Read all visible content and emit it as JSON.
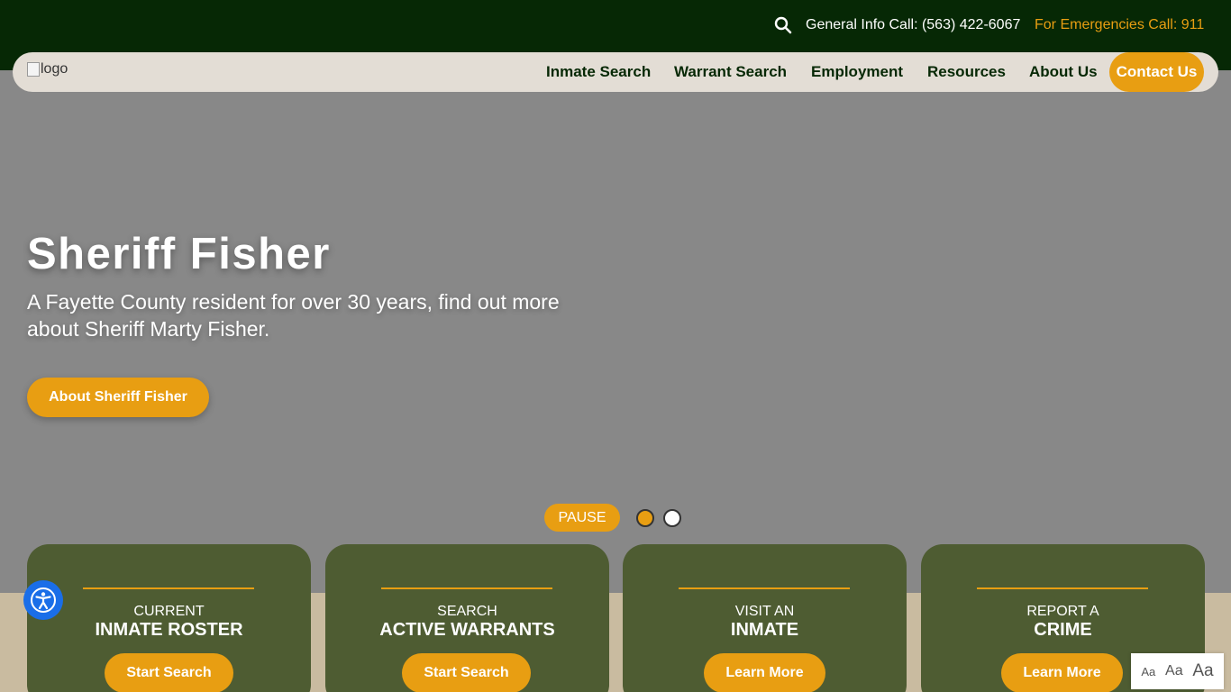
{
  "topbar": {
    "general_info": "General Info Call: (563) 422-6067",
    "emergency": "For Emergencies Call: 911",
    "search_icon": "search-icon"
  },
  "navbar": {
    "logo_alt": "logo",
    "links": [
      "Inmate Search",
      "Warrant Search",
      "Employment",
      "Resources",
      "About Us"
    ],
    "contact": "Contact Us"
  },
  "hero": {
    "title": "Sheriff Fisher",
    "subtitle": "A Fayette County resident for over 30 years, find out more about Sheriff Marty Fisher.",
    "button": "About Sheriff Fisher",
    "pause": "PAUSE"
  },
  "cards": [
    {
      "small": "CURRENT",
      "big": "INMATE ROSTER",
      "button": "Start Search"
    },
    {
      "small": "SEARCH",
      "big": "ACTIVE WARRANTS",
      "button": "Start Search"
    },
    {
      "small": "VISIT AN",
      "big": "INMATE",
      "button": "Learn More"
    },
    {
      "small": "REPORT A",
      "big": "CRIME",
      "button": "Learn More"
    }
  ],
  "font_sizer": [
    "Aa",
    "Aa",
    "Aa"
  ],
  "colors": {
    "dark_green": "#062805",
    "accent": "#e89e12",
    "card_green": "#4e5c32",
    "nav_bg": "#e3ddd5",
    "hero_bg": "#888888",
    "accessibility_blue": "#1a6ee8"
  }
}
